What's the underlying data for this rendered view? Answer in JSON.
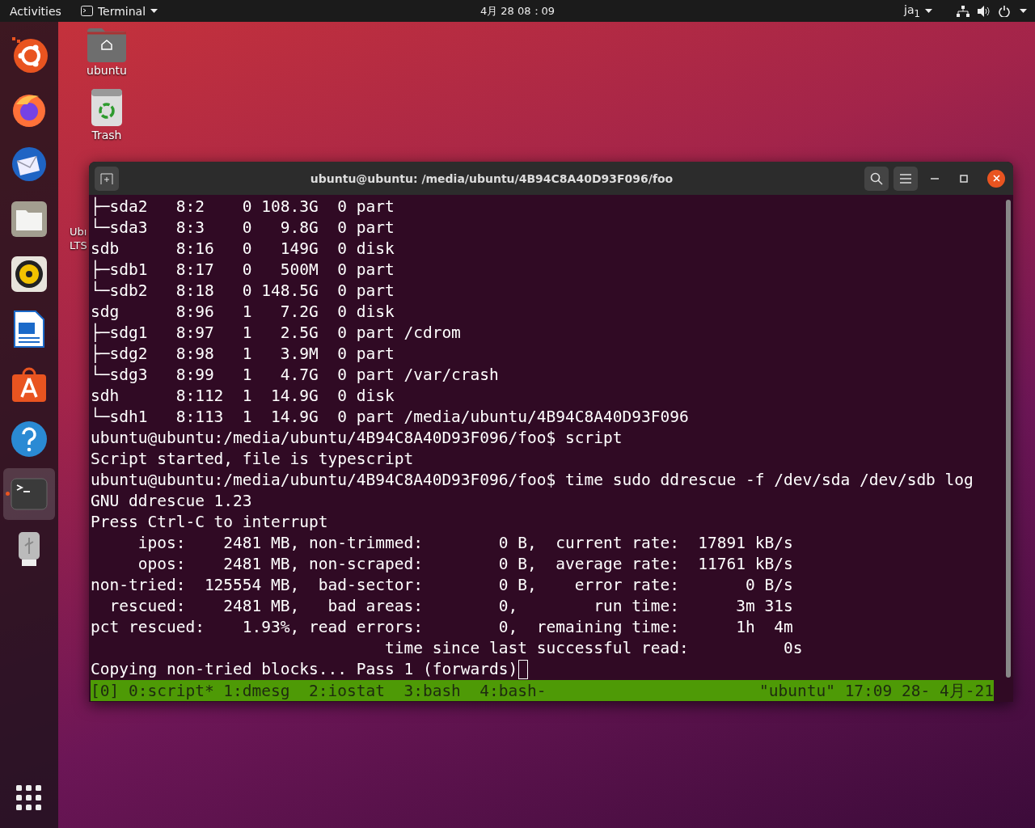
{
  "top_bar": {
    "activities": "Activities",
    "app_menu": "Terminal",
    "clock": "4月 28 08：09",
    "input_method": "ja$_{1}$"
  },
  "dock": {
    "items": [
      {
        "kind": "installer",
        "selected": false,
        "running": false
      },
      {
        "kind": "browser",
        "selected": false,
        "running": false
      },
      {
        "kind": "mail",
        "selected": false,
        "running": false
      },
      {
        "kind": "files",
        "selected": false,
        "running": false
      },
      {
        "kind": "music",
        "selected": false,
        "running": false
      },
      {
        "kind": "writer",
        "selected": false,
        "running": false
      },
      {
        "kind": "store",
        "selected": false,
        "running": false
      },
      {
        "kind": "help",
        "selected": false,
        "running": false
      },
      {
        "kind": "terminal",
        "selected": true,
        "running": true
      },
      {
        "kind": "usb",
        "selected": false,
        "running": false
      }
    ]
  },
  "desktop": {
    "icons": [
      {
        "kind": "home",
        "label": "ubuntu"
      },
      {
        "kind": "trash",
        "label": "Trash"
      }
    ],
    "covered_label": [
      "Ubı",
      "LTS"
    ]
  },
  "terminal": {
    "title": "ubuntu@ubuntu: /media/ubuntu/4B94C8A40D93F096/foo",
    "lines": [
      "├─sda2   8:2    0 108.3G  0 part",
      "└─sda3   8:3    0   9.8G  0 part",
      "sdb      8:16   0   149G  0 disk",
      "├─sdb1   8:17   0   500M  0 part",
      "└─sdb2   8:18   0 148.5G  0 part",
      "sdg      8:96   1   7.2G  0 disk",
      "├─sdg1   8:97   1   2.5G  0 part /cdrom",
      "├─sdg2   8:98   1   3.9M  0 part",
      "└─sdg3   8:99   1   4.7G  0 part /var/crash",
      "sdh      8:112  1  14.9G  0 disk",
      "└─sdh1   8:113  1  14.9G  0 part /media/ubuntu/4B94C8A40D93F096",
      "ubuntu@ubuntu:/media/ubuntu/4B94C8A40D93F096/foo$ script",
      "Script started, file is typescript",
      "ubuntu@ubuntu:/media/ubuntu/4B94C8A40D93F096/foo$ time sudo ddrescue -f /dev/sda /dev/sdb log",
      "GNU ddrescue 1.23",
      "Press Ctrl-C to interrupt",
      "     ipos:    2481 MB, non-trimmed:        0 B,  current rate:  17891 kB/s",
      "     opos:    2481 MB, non-scraped:        0 B,  average rate:  11761 kB/s",
      "non-tried:  125554 MB,  bad-sector:        0 B,    error rate:       0 B/s",
      "  rescued:    2481 MB,   bad areas:        0,        run time:      3m 31s",
      "pct rescued:    1.93%, read errors:        0,  remaining time:      1h  4m",
      "                               time since last successful read:          0s",
      "Copying non-tried blocks... Pass 1 (forwards)"
    ],
    "status_left": "[0] 0:script* 1:dmesg  2:iostat  3:bash  4:bash-",
    "status_right": "\"ubuntu\" 17:09 28- 4月-21"
  }
}
